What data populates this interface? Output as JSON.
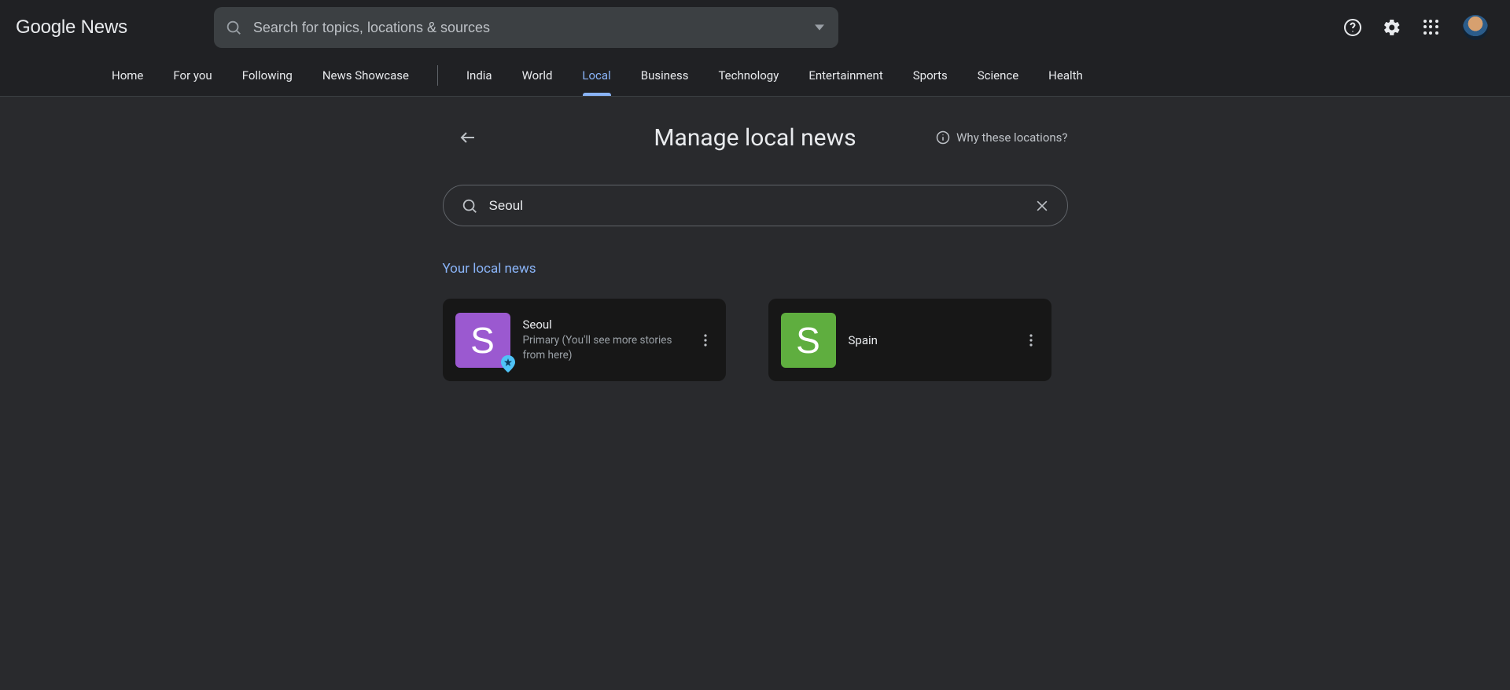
{
  "header": {
    "logo": "Google News",
    "search_placeholder": "Search for topics, locations & sources"
  },
  "nav": {
    "items_left": [
      "Home",
      "For you",
      "Following",
      "News Showcase"
    ],
    "items_right": [
      "India",
      "World",
      "Local",
      "Business",
      "Technology",
      "Entertainment",
      "Sports",
      "Science",
      "Health"
    ],
    "active": "Local"
  },
  "page": {
    "title": "Manage local news",
    "why_link": "Why these locations?",
    "location_search_value": "Seoul",
    "section_title": "Your local news"
  },
  "cards": [
    {
      "letter": "S",
      "color": "purple",
      "title": "Seoul",
      "subtitle": "Primary (You'll see more stories from here)",
      "primary": true
    },
    {
      "letter": "S",
      "color": "green",
      "title": "Spain",
      "subtitle": "",
      "primary": false
    }
  ]
}
